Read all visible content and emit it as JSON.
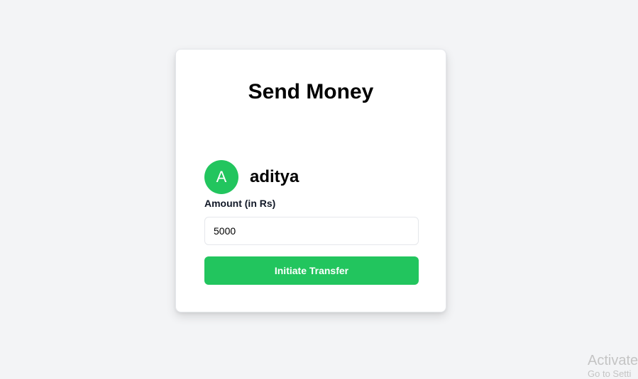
{
  "page": {
    "title": "Send Money"
  },
  "recipient": {
    "avatar_initial": "A",
    "name": "aditya"
  },
  "amount": {
    "label": "Amount (in Rs)",
    "value": "5000"
  },
  "actions": {
    "transfer_label": "Initiate Transfer"
  },
  "overlay": {
    "watermark_title": "Activate",
    "watermark_subtitle": "Go to Setti"
  },
  "colors": {
    "background": "#f3f4f6",
    "card": "#ffffff",
    "accent": "#22c55e",
    "button_text": "#ffffff"
  }
}
